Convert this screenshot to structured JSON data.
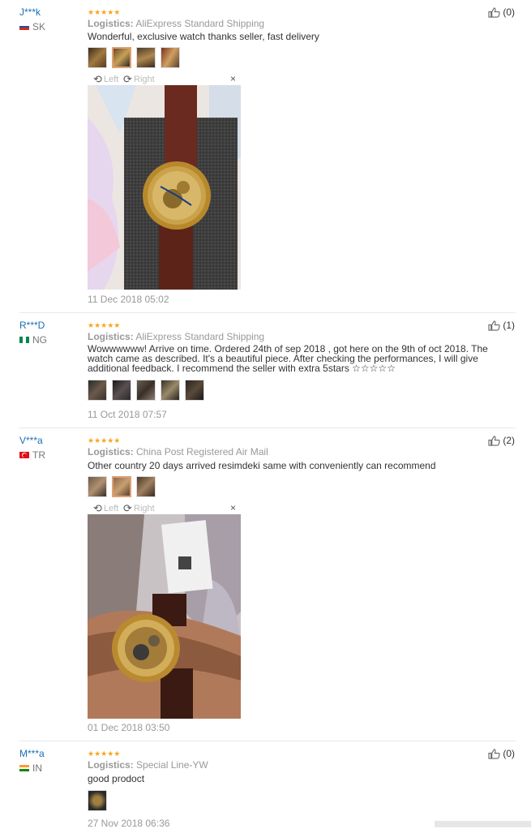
{
  "reviews": [
    {
      "user": "J***k",
      "country": "SK",
      "logistics_label": "Logistics:",
      "logistics": "AliExpress Standard Shipping",
      "text": "Wonderful, exclusive watch thanks seller, fast delivery",
      "helpful": "(0)",
      "date": "11 Dec 2018 05:02",
      "thumb_count": 4,
      "viewer_left": "Left",
      "viewer_right": "Right"
    },
    {
      "user": "R***D",
      "country": "NG",
      "logistics_label": "Logistics:",
      "logistics": "AliExpress Standard Shipping",
      "text": "Wowwwwww! Arrive on time. Ordered 24th of sep 2018 , got here on the 9th of oct 2018. The watch came as described. It's a beautiful piece. After checking the performances, I will give additional feedback. I recommend the seller with extra 5stars ☆☆☆☆☆",
      "helpful": "(1)",
      "date": "11 Oct 2018 07:57",
      "thumb_count": 5
    },
    {
      "user": "V***a",
      "country": "TR",
      "logistics_label": "Logistics:",
      "logistics": "China Post Registered Air Mail",
      "text": "Other country 20 days arrived resimdeki same with conveniently can recommend",
      "helpful": "(2)",
      "date": "01 Dec 2018 03:50",
      "thumb_count": 3,
      "viewer_left": "Left",
      "viewer_right": "Right"
    },
    {
      "user": "M***a",
      "country": "IN",
      "logistics_label": "Logistics:",
      "logistics": "Special Line-YW",
      "text": "good prodoct",
      "helpful": "(0)",
      "date": "27 Nov 2018 06:36",
      "thumb_count": 1
    }
  ],
  "stars": "★★★★★",
  "icons": {
    "helpful": "thumbs-up-icon",
    "rotate_left": "rotate-left-icon",
    "rotate_right": "rotate-right-icon",
    "close": "close-icon"
  },
  "colors": {
    "username": "#1a6fb5",
    "stars": "#f5a623",
    "muted": "#999999"
  }
}
